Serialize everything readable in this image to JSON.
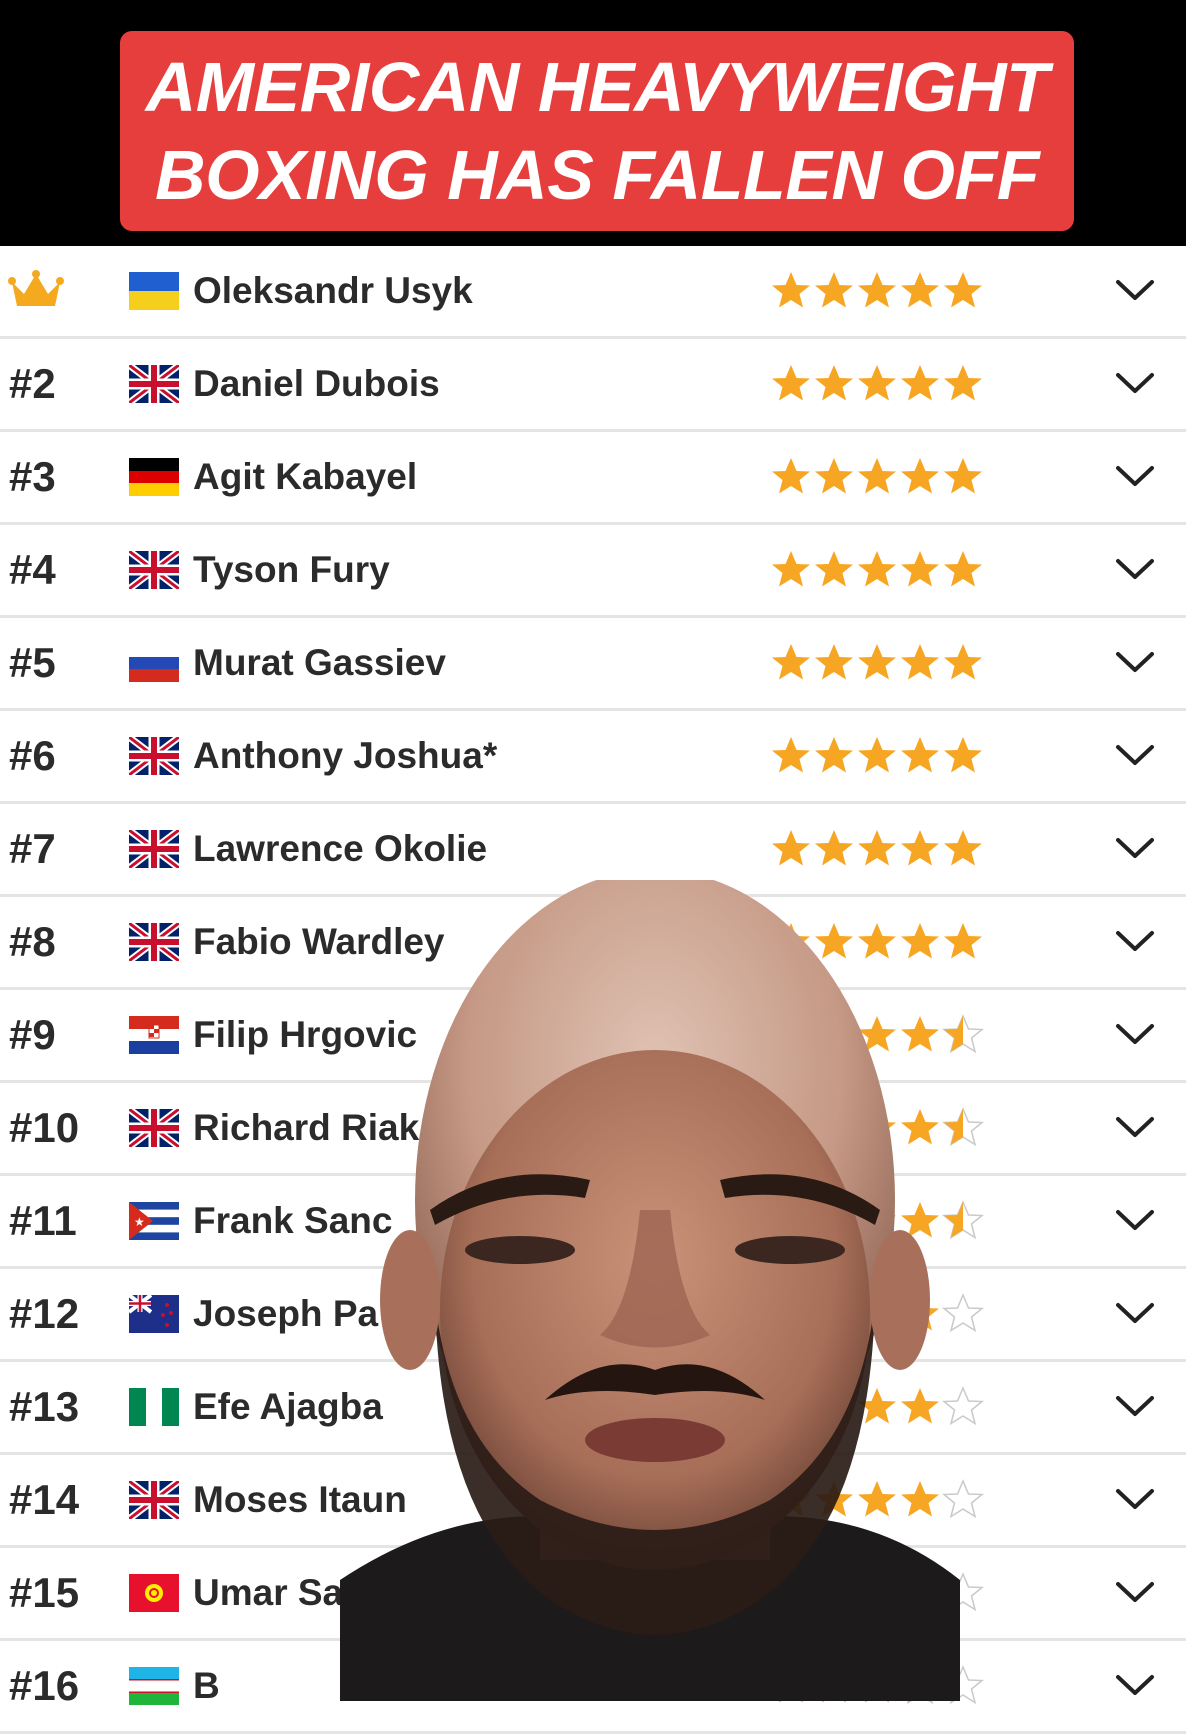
{
  "banner": {
    "line1": "AMERICAN HEAVYWEIGHT",
    "line2": "BOXING HAS FALLEN OFF"
  },
  "colors": {
    "banner_bg": "#e53e3d",
    "star_fill": "#f7a623",
    "crown": "#f5a91f",
    "text": "#2b2b2b"
  },
  "rankings": [
    {
      "rank": "",
      "is_champion": true,
      "name": "Oleksandr Usyk",
      "flag": "ukraine",
      "rating": 5
    },
    {
      "rank": "#2",
      "name": "Daniel Dubois",
      "flag": "uk",
      "rating": 5
    },
    {
      "rank": "#3",
      "name": "Agit Kabayel",
      "flag": "germany",
      "rating": 5
    },
    {
      "rank": "#4",
      "name": "Tyson Fury",
      "flag": "uk",
      "rating": 5
    },
    {
      "rank": "#5",
      "name": "Murat Gassiev",
      "flag": "russia",
      "rating": 5
    },
    {
      "rank": "#6",
      "name": "Anthony Joshua*",
      "flag": "uk",
      "rating": 5
    },
    {
      "rank": "#7",
      "name": "Lawrence Okolie",
      "flag": "uk",
      "rating": 5
    },
    {
      "rank": "#8",
      "name": "Fabio Wardley",
      "flag": "uk",
      "rating": 5
    },
    {
      "rank": "#9",
      "name": "Filip Hrgovic",
      "flag": "croatia",
      "rating": 4.5
    },
    {
      "rank": "#10",
      "name": "Richard Riak",
      "flag": "uk",
      "rating": 4.5
    },
    {
      "rank": "#11",
      "name": "Frank Sanc",
      "flag": "cuba",
      "rating": 4.5
    },
    {
      "rank": "#12",
      "name": "Joseph Pa",
      "flag": "new-zealand",
      "rating": 4
    },
    {
      "rank": "#13",
      "name": "Efe Ajagba",
      "flag": "nigeria",
      "rating": 4
    },
    {
      "rank": "#14",
      "name": "Moses Itaun",
      "flag": "uk",
      "rating": 4
    },
    {
      "rank": "#15",
      "name": "Umar Salam",
      "flag": "kyrgyzstan",
      "rating": 4
    },
    {
      "rank": "#16",
      "name": "B",
      "flag": "uzbekistan",
      "rating": 3.5
    }
  ],
  "icons": {
    "champion": "crown-icon",
    "expand": "chevron-down-icon",
    "rating": "star-icon"
  }
}
